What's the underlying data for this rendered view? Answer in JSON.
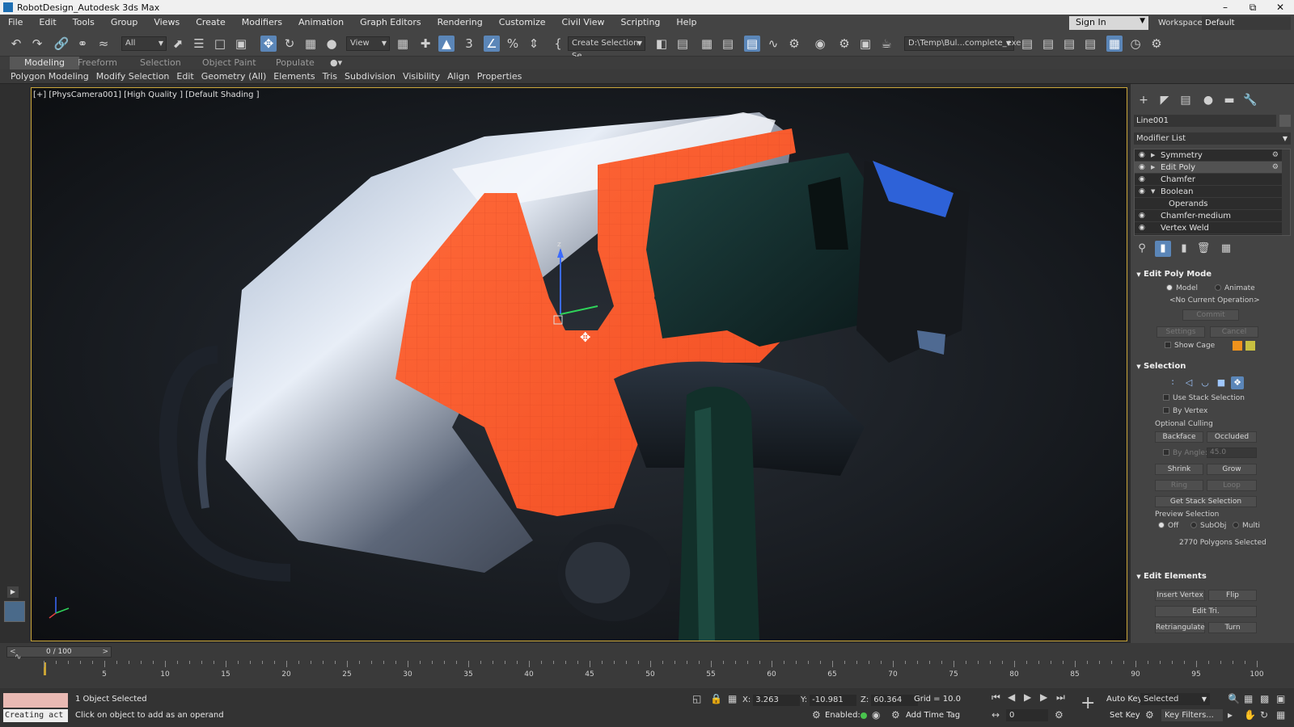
{
  "window": {
    "title": "RobotDesign_Autodesk 3ds Max"
  },
  "menu": [
    "File",
    "Edit",
    "Tools",
    "Group",
    "Views",
    "Create",
    "Modifiers",
    "Animation",
    "Graph Editors",
    "Rendering",
    "Customize",
    "Civil View",
    "Scripting",
    "Help"
  ],
  "header": {
    "sign_in": "Sign In",
    "workspaces_label": "Workspaces:",
    "workspace": "Default"
  },
  "toolbar": {
    "filter": "All",
    "reference_coord": "View",
    "named_selection": "Create Selection Se",
    "project_path": "D:\\Temp\\Bul...complete_exe"
  },
  "ribbon": {
    "tabs": [
      "Modeling",
      "Freeform",
      "Selection",
      "Object Paint",
      "Populate"
    ],
    "panels": [
      "Polygon Modeling",
      "Modify Selection",
      "Edit",
      "Geometry (All)",
      "Elements",
      "Tris",
      "Subdivision",
      "Visibility",
      "Align",
      "Properties"
    ]
  },
  "viewport": {
    "label": "[+] [PhysCamera001] [High Quality ] [Default Shading ]"
  },
  "command_panel": {
    "object_name": "Line001",
    "modifier_list": "Modifier List",
    "stack": [
      "Symmetry",
      "Edit Poly",
      "Chamfer",
      "Boolean",
      "Operands",
      "Chamfer-medium",
      "Vertex Weld"
    ],
    "edit_poly_mode": {
      "title": "Edit Poly Mode",
      "model": "Model",
      "animate": "Animate",
      "current_op": "<No Current Operation>",
      "commit": "Commit",
      "settings": "Settings",
      "cancel": "Cancel",
      "show_cage": "Show Cage",
      "cage_colors": [
        "#f0921c",
        "#c8c040"
      ]
    },
    "selection": {
      "title": "Selection",
      "use_stack": "Use Stack Selection",
      "by_vertex": "By Vertex",
      "optional_culling": "Optional Culling",
      "backface": "Backface",
      "occluded": "Occluded",
      "by_angle": "By Angle:",
      "angle_value": "45.0",
      "shrink": "Shrink",
      "grow": "Grow",
      "ring": "Ring",
      "loop": "Loop",
      "get_stack": "Get Stack Selection",
      "preview": "Preview Selection",
      "off": "Off",
      "subobj": "SubObj",
      "multi": "Multi",
      "status": "2770 Polygons Selected"
    },
    "edit_elements": {
      "title": "Edit Elements",
      "insert_vertex": "Insert Vertex",
      "flip": "Flip",
      "edit_tri": "Edit Tri.",
      "retriangulate": "Retriangulate",
      "turn": "Turn"
    }
  },
  "timeline": {
    "position": "0 / 100",
    "ticks": [
      "5",
      "10",
      "15",
      "20",
      "25",
      "30",
      "35",
      "40",
      "45",
      "50",
      "55",
      "60",
      "65",
      "70",
      "75",
      "80",
      "85",
      "90",
      "95",
      "100"
    ]
  },
  "status": {
    "listener": "Creating act",
    "selected": "1 Object Selected",
    "prompt": "Click on object to add as an operand",
    "x_label": "X:",
    "x": "3.263",
    "y_label": "Y:",
    "y": "-10.981",
    "z_label": "Z:",
    "z": "60.364",
    "grid": "Grid = 10.0",
    "enabled": "Enabled:",
    "add_time_tag": "Add Time Tag",
    "auto_key": "Auto Key",
    "key_mode": "Selected",
    "set_key": "Set Key",
    "key_filters": "Key Filters...",
    "frame": "0"
  },
  "colors": {
    "accent": "#5b86b8",
    "selection": "#ff5a2e",
    "viewport_border": "#caa63a"
  }
}
